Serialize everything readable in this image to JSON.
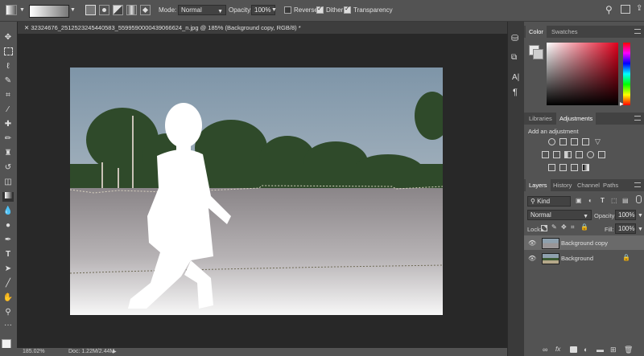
{
  "options_bar": {
    "mode_label": "Mode:",
    "mode_value": "Normal",
    "opacity_label": "Opacity:",
    "opacity_value": "100%",
    "reverse_label": "Reverse",
    "reverse_checked": false,
    "dither_label": "Dither",
    "dither_checked": true,
    "transparency_label": "Transparency",
    "transparency_checked": true,
    "search_icon": "search-icon",
    "workspace_icon": "workspace-icon",
    "share_icon": "share-icon"
  },
  "document": {
    "tab_title": "32324676_2512523245440583_5599590000439066624_n.jpg @ 185% (Background copy, RGB/8) *"
  },
  "status_bar": {
    "zoom": "185.02%",
    "doc_info": "Doc: 1.22M/2.44M"
  },
  "color_panel": {
    "tabs": [
      "Color",
      "Swatches"
    ],
    "active_tab": "Color",
    "hue_color": "#e1001c"
  },
  "adjustments_panel": {
    "tabs": [
      "Libraries",
      "Adjustments"
    ],
    "active_tab": "Adjustments",
    "heading": "Add an adjustment"
  },
  "layers_panel": {
    "tabs": [
      "Layers",
      "History",
      "Channel",
      "Paths"
    ],
    "active_tab": "Layers",
    "filter_label": "Kind",
    "blend_mode": "Normal",
    "opacity_label": "Opacity:",
    "opacity_value": "100%",
    "lock_label": "Lock:",
    "fill_label": "Fill:",
    "fill_value": "100%",
    "layers": [
      {
        "name": "Background copy",
        "selected": true,
        "locked": false
      },
      {
        "name": "Background",
        "selected": false,
        "locked": true
      }
    ]
  }
}
